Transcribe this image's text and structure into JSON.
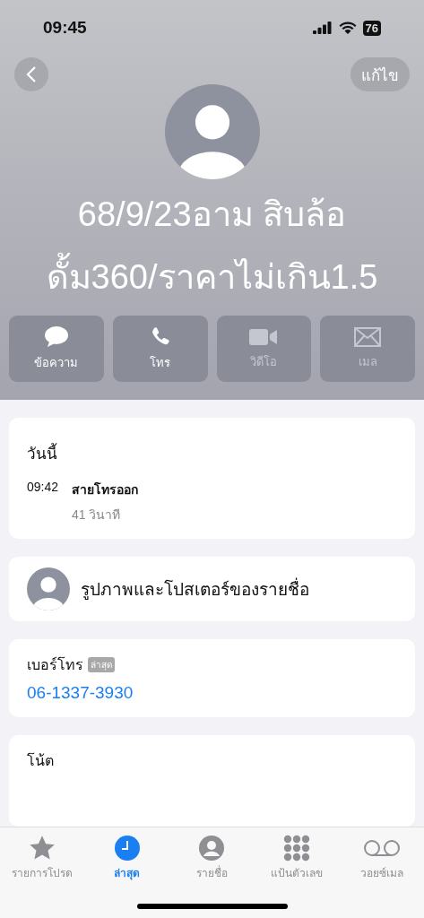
{
  "status_bar": {
    "time": "09:45",
    "battery": "76"
  },
  "nav": {
    "edit": "แก้ไข"
  },
  "contact": {
    "name_lines": [
      "68/9/23อาม สิบล้อ",
      "ดั้ม360/ราคาไม่เกิน1.5"
    ]
  },
  "actions": [
    {
      "kind": "message",
      "label": "ข้อความ",
      "disabled": false
    },
    {
      "kind": "call",
      "label": "โทร",
      "disabled": false
    },
    {
      "kind": "video",
      "label": "วิดีโอ",
      "disabled": true
    },
    {
      "kind": "mail",
      "label": "เมล",
      "disabled": true
    }
  ],
  "call_history": {
    "heading": "วันนี้",
    "entries": [
      {
        "time": "09:42",
        "type": "สายโทรออก",
        "duration": "41 วินาที"
      }
    ]
  },
  "poster": {
    "label": "รูปภาพและโปสเตอร์ของรายชื่อ"
  },
  "phone": {
    "label": "เบอร์โทร",
    "badge": "ล่าสุด",
    "number": "06-1337-3930"
  },
  "notes": {
    "label": "โน้ต"
  },
  "tabs": [
    {
      "kind": "favorites",
      "label": "รายการโปรด",
      "selected": false
    },
    {
      "kind": "recents",
      "label": "ล่าสุด",
      "selected": true
    },
    {
      "kind": "contacts",
      "label": "รายชื่อ",
      "selected": false
    },
    {
      "kind": "keypad",
      "label": "แป้นตัวเลข",
      "selected": false
    },
    {
      "kind": "voicemail",
      "label": "วอยซ์เมล",
      "selected": false
    }
  ]
}
